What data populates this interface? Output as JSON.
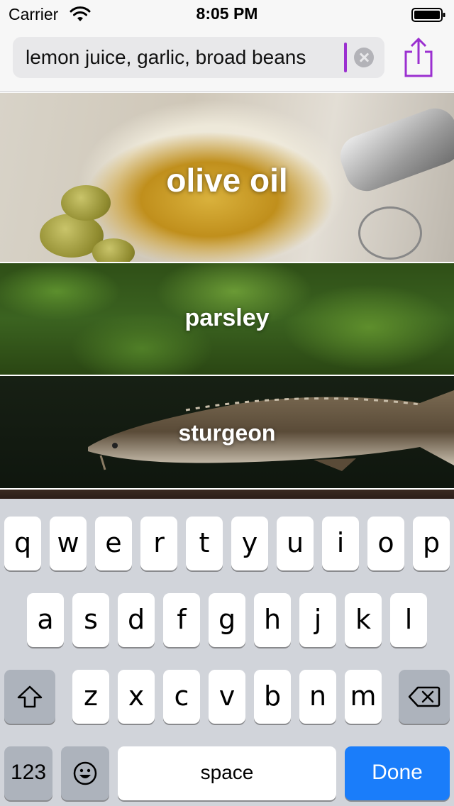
{
  "status_bar": {
    "carrier": "Carrier",
    "time": "8:05 PM",
    "icons": [
      "wifi-icon",
      "battery-icon"
    ]
  },
  "search": {
    "value": "lemon juice, garlic, broad beans",
    "clear_icon": "clear-icon",
    "share_icon": "share-icon"
  },
  "ingredients": [
    {
      "label": "olive oil"
    },
    {
      "label": "parsley"
    },
    {
      "label": "sturgeon"
    }
  ],
  "keyboard": {
    "row1": [
      "q",
      "w",
      "e",
      "r",
      "t",
      "y",
      "u",
      "i",
      "o",
      "p"
    ],
    "row2": [
      "a",
      "s",
      "d",
      "f",
      "g",
      "h",
      "j",
      "k",
      "l"
    ],
    "row3": [
      "z",
      "x",
      "c",
      "v",
      "b",
      "n",
      "m"
    ],
    "shift_icon": "shift-icon",
    "delete_icon": "delete-icon",
    "numbers_label": "123",
    "emoji_icon": "emoji-icon",
    "space_label": "space",
    "done_label": "Done"
  },
  "colors": {
    "accent": "#9b30d0",
    "done_button": "#1a7dfa",
    "keyboard_bg": "#d1d4da"
  }
}
